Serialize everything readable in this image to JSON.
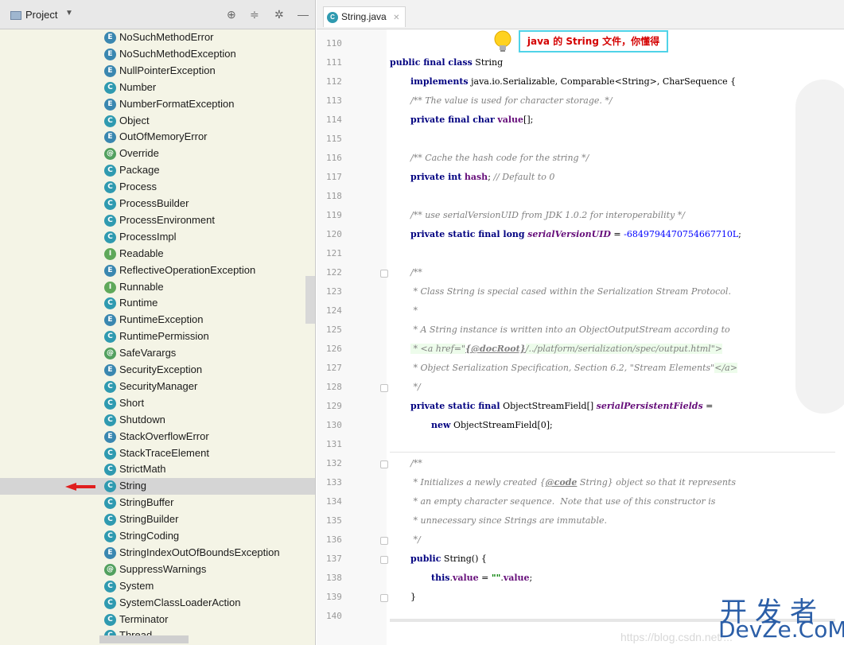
{
  "project": {
    "title": "Project",
    "items": [
      {
        "label": "NoSuchMethodError",
        "icon": "exc"
      },
      {
        "label": "NoSuchMethodException",
        "icon": "exc"
      },
      {
        "label": "NullPointerException",
        "icon": "exc"
      },
      {
        "label": "Number",
        "icon": "class"
      },
      {
        "label": "NumberFormatException",
        "icon": "exc"
      },
      {
        "label": "Object",
        "icon": "class"
      },
      {
        "label": "OutOfMemoryError",
        "icon": "exc"
      },
      {
        "label": "Override",
        "icon": "anno"
      },
      {
        "label": "Package",
        "icon": "class"
      },
      {
        "label": "Process",
        "icon": "class"
      },
      {
        "label": "ProcessBuilder",
        "icon": "class"
      },
      {
        "label": "ProcessEnvironment",
        "icon": "class"
      },
      {
        "label": "ProcessImpl",
        "icon": "class"
      },
      {
        "label": "Readable",
        "icon": "iface"
      },
      {
        "label": "ReflectiveOperationException",
        "icon": "exc"
      },
      {
        "label": "Runnable",
        "icon": "iface"
      },
      {
        "label": "Runtime",
        "icon": "class"
      },
      {
        "label": "RuntimeException",
        "icon": "exc"
      },
      {
        "label": "RuntimePermission",
        "icon": "class"
      },
      {
        "label": "SafeVarargs",
        "icon": "anno"
      },
      {
        "label": "SecurityException",
        "icon": "exc"
      },
      {
        "label": "SecurityManager",
        "icon": "class"
      },
      {
        "label": "Short",
        "icon": "class"
      },
      {
        "label": "Shutdown",
        "icon": "class"
      },
      {
        "label": "StackOverflowError",
        "icon": "exc"
      },
      {
        "label": "StackTraceElement",
        "icon": "class"
      },
      {
        "label": "StrictMath",
        "icon": "class"
      },
      {
        "label": "String",
        "icon": "class",
        "selected": true
      },
      {
        "label": "StringBuffer",
        "icon": "class"
      },
      {
        "label": "StringBuilder",
        "icon": "class"
      },
      {
        "label": "StringCoding",
        "icon": "class"
      },
      {
        "label": "StringIndexOutOfBoundsException",
        "icon": "exc"
      },
      {
        "label": "SuppressWarnings",
        "icon": "anno"
      },
      {
        "label": "System",
        "icon": "class"
      },
      {
        "label": "SystemClassLoaderAction",
        "icon": "class"
      },
      {
        "label": "Terminator",
        "icon": "class"
      },
      {
        "label": "Thread",
        "icon": "class"
      }
    ]
  },
  "editor": {
    "tab_label": "String.java",
    "callout": "java 的 String 文件，你懂得",
    "line_numbers": [
      "110",
      "111",
      "112",
      "113",
      "114",
      "115",
      "116",
      "117",
      "118",
      "119",
      "120",
      "121",
      "122",
      "123",
      "124",
      "125",
      "126",
      "127",
      "128",
      "129",
      "130",
      "131",
      "132",
      "133",
      "134",
      "135",
      "136",
      "137",
      "138",
      "139",
      "140"
    ],
    "code": {
      "l111": {
        "kw": "public final class",
        "rest": " String"
      },
      "l112": {
        "kw": "implements",
        "rest": " java.io.Serializable, Comparable<String>, CharSequence {"
      },
      "l113": "/** The value is used for character storage. */",
      "l114": {
        "kw": "private final char",
        "field": "value",
        "rest": "[];"
      },
      "l116": "/** Cache the hash code for the string */",
      "l117": {
        "kw": "private int",
        "field": "hash",
        "rest": "; ",
        "comment": "// Default to 0"
      },
      "l119": "/** use serialVersionUID from JDK 1.0.2 for interoperability */",
      "l120": {
        "kw": "private static final long",
        "field": "serialVersionUID",
        "rest": " = ",
        "num": "-6849794470754667710L",
        "end": ";"
      },
      "l122": "/**",
      "l123": " * Class String is special cased within the Serialization Stream Protocol.",
      "l124": " *",
      "l125": " * A String instance is written into an ObjectOutputStream according to",
      "l126a": " * <a href=\"",
      "l126tag": "{@docRoot}",
      "l126b": "/../platform/serialization/spec/output.html\">",
      "l127": " * Object Serialization Specification, Section 6.2, \"Stream Elements\"",
      "l127tag": "</a>",
      "l128": " */",
      "l129": {
        "kw": "private static final",
        "type": " ObjectStreamField[] ",
        "field": "serialPersistentFields",
        "rest": " ="
      },
      "l130": {
        "kw": "new",
        "rest": " ObjectStreamField[0];"
      },
      "l132": "/**",
      "l133a": " * Initializes a newly created {",
      "l133tag": "@code",
      "l133b": " String} object so that it represents",
      "l134": " * an empty character sequence.  Note that use of this constructor is",
      "l135": " * unnecessary since Strings are immutable.",
      "l136": " */",
      "l137": {
        "kw": "public",
        "rest": " String() {"
      },
      "l138": {
        "kw": "this",
        "rest": ".",
        "field": "value",
        "mid": " = ",
        "str": "\"\"",
        "rest2": ".",
        "field2": "value",
        "end": ";"
      },
      "l139": "}"
    }
  },
  "watermark": {
    "cn": "开发者",
    "en": "DevZe.CoM",
    "url": "https://blog.csdn.net/..."
  }
}
